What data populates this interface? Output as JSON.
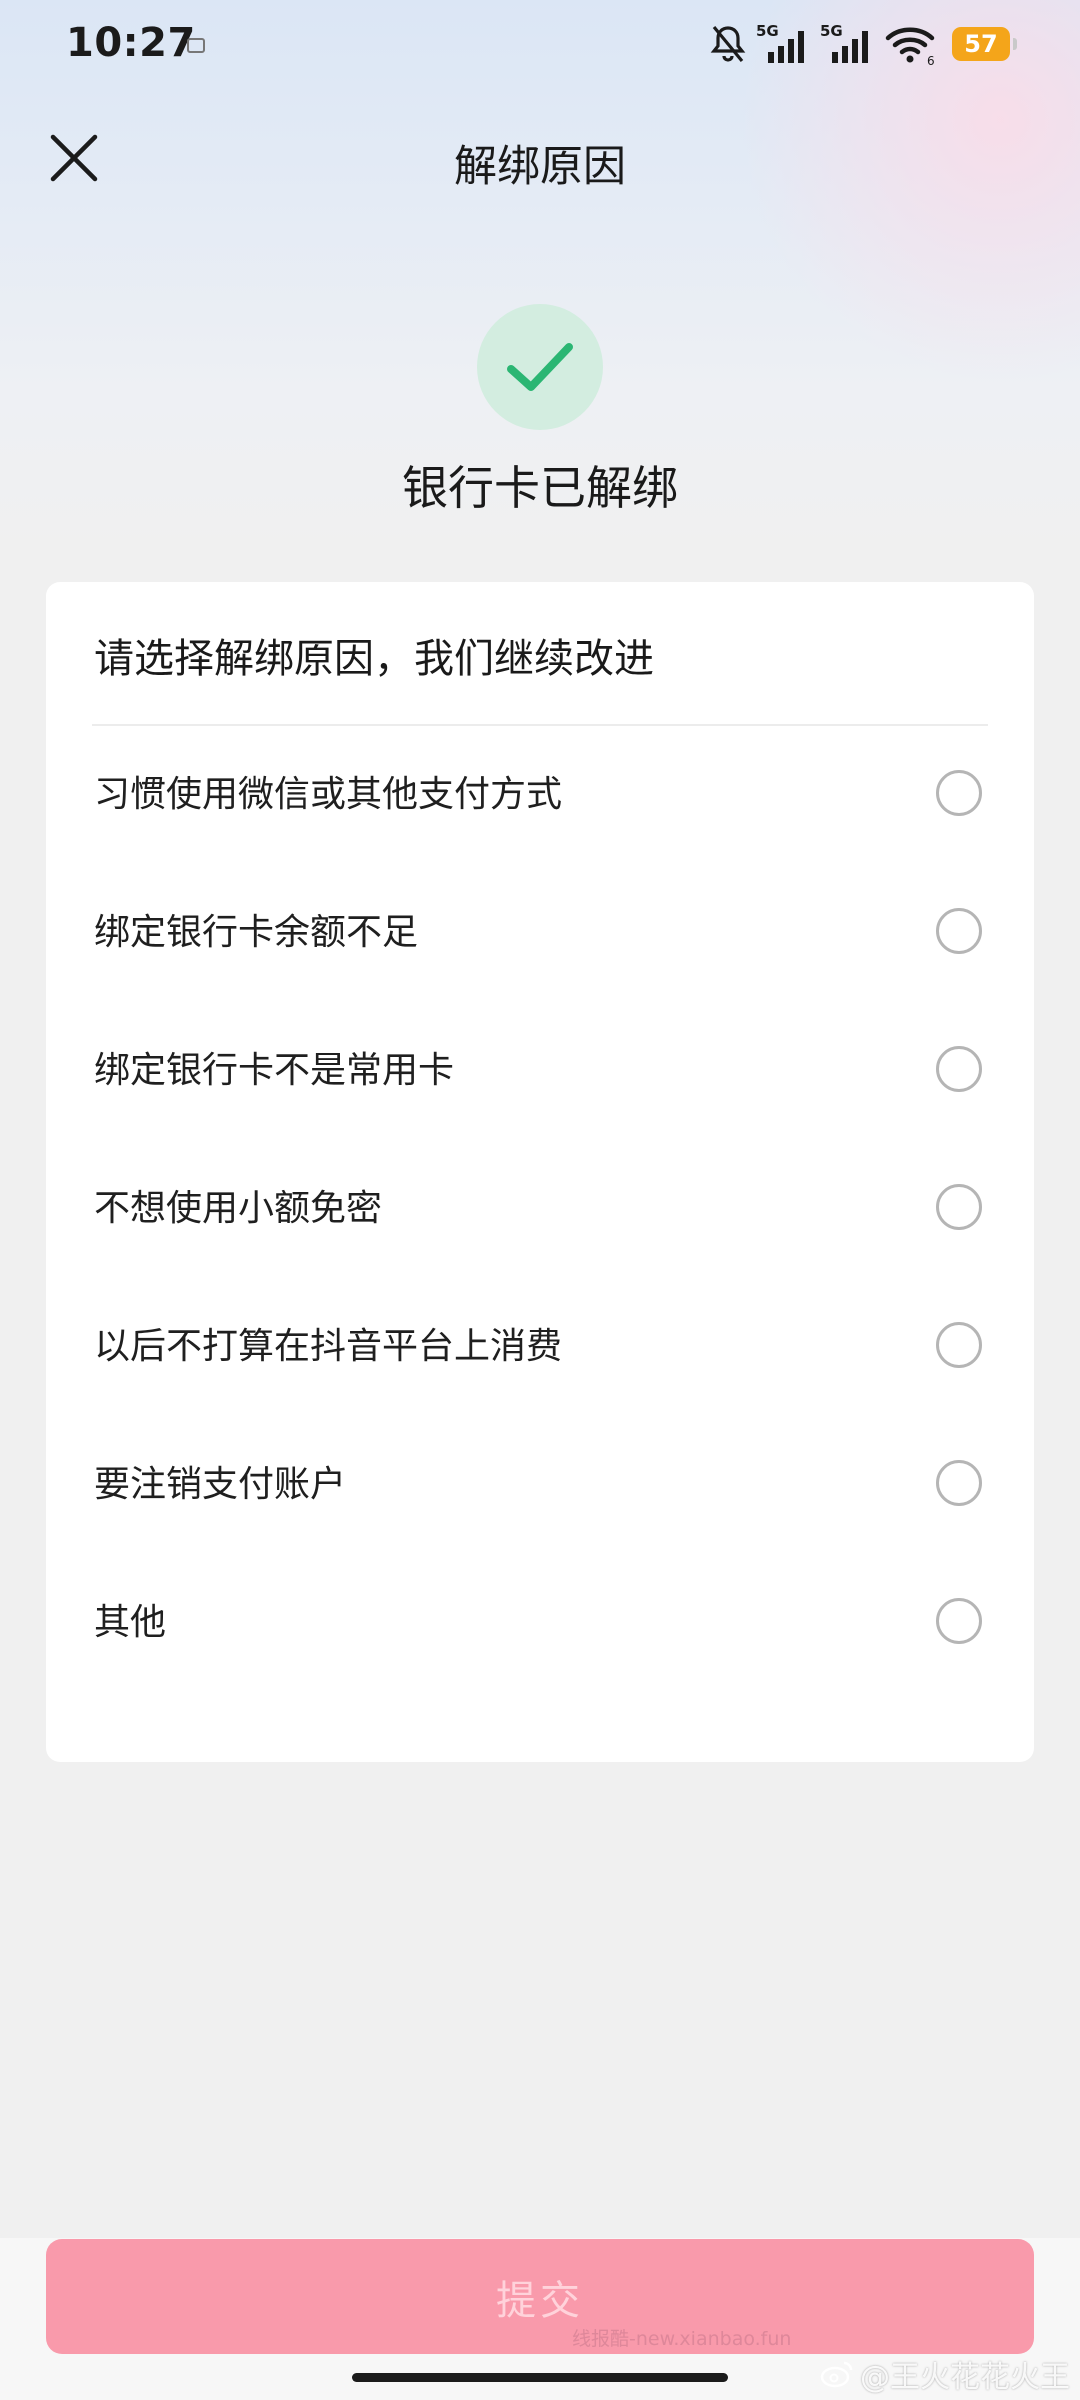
{
  "status_bar": {
    "time": "10:27",
    "battery": "57",
    "network_1": "5G",
    "network_2": "5G",
    "wifi_sub": "6",
    "icons": [
      "message-icon",
      "bell-muted-icon",
      "signal-icon",
      "wifi-icon",
      "battery-icon"
    ]
  },
  "header": {
    "title": "解绑原因"
  },
  "success": {
    "message": "银行卡已解绑",
    "icon": "check-icon",
    "color": "#2bb673"
  },
  "form": {
    "prompt": "请选择解绑原因，我们继续改进",
    "reasons": [
      {
        "label": "习惯使用微信或其他支付方式",
        "selected": false
      },
      {
        "label": "绑定银行卡余额不足",
        "selected": false
      },
      {
        "label": "绑定银行卡不是常用卡",
        "selected": false
      },
      {
        "label": "不想使用小额免密",
        "selected": false
      },
      {
        "label": "以后不打算在抖音平台上消费",
        "selected": false
      },
      {
        "label": "要注销支付账户",
        "selected": false
      },
      {
        "label": "其他",
        "selected": false
      }
    ]
  },
  "footer": {
    "submit_label": "提交",
    "submit_color": "#f99aab",
    "watermark_site": "线报酷-new.xianbao.fun",
    "watermark_user": "@王火花花火王"
  }
}
